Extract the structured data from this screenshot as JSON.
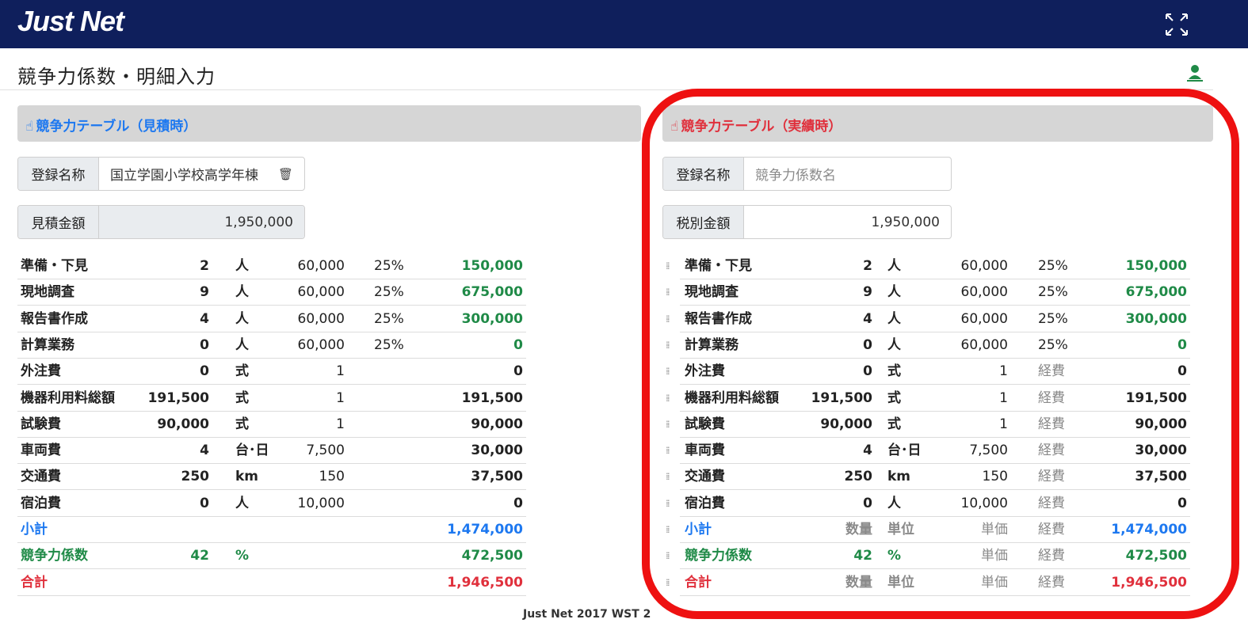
{
  "header": {
    "logo": "Just Net"
  },
  "page": {
    "title": "競争力係数・明細入力"
  },
  "left_panel": {
    "title": "競争力テーブル（見積時）",
    "fields": {
      "name_label": "登録名称",
      "name_value": "国立学園小学校高学年棟",
      "amount_label": "見積金額",
      "amount_value": "1,950,000"
    },
    "rows": [
      {
        "item": "準備・下見",
        "qty": "2",
        "unit": "人",
        "price": "60,000",
        "rate": "25%",
        "amount": "150,000",
        "kind": "green"
      },
      {
        "item": "現地調査",
        "qty": "9",
        "unit": "人",
        "price": "60,000",
        "rate": "25%",
        "amount": "675,000",
        "kind": "green"
      },
      {
        "item": "報告書作成",
        "qty": "4",
        "unit": "人",
        "price": "60,000",
        "rate": "25%",
        "amount": "300,000",
        "kind": "green"
      },
      {
        "item": "計算業務",
        "qty": "0",
        "unit": "人",
        "price": "60,000",
        "rate": "25%",
        "amount": "0",
        "kind": "green"
      },
      {
        "item": "外注費",
        "qty": "0",
        "unit": "式",
        "price": "1",
        "rate": "",
        "amount": "0",
        "kind": "black"
      },
      {
        "item": "機器利用料総額",
        "qty": "191,500",
        "unit": "式",
        "price": "1",
        "rate": "",
        "amount": "191,500",
        "kind": "black"
      },
      {
        "item": "試験費",
        "qty": "90,000",
        "unit": "式",
        "price": "1",
        "rate": "",
        "amount": "90,000",
        "kind": "black"
      },
      {
        "item": "車両費",
        "qty": "4",
        "unit": "台･日",
        "price": "7,500",
        "rate": "",
        "amount": "30,000",
        "kind": "black"
      },
      {
        "item": "交通費",
        "qty": "250",
        "unit": "km",
        "price": "150",
        "rate": "",
        "amount": "37,500",
        "kind": "black"
      },
      {
        "item": "宿泊費",
        "qty": "0",
        "unit": "人",
        "price": "10,000",
        "rate": "",
        "amount": "0",
        "kind": "black"
      }
    ],
    "summary": [
      {
        "item": "小計",
        "qty": "",
        "unit": "",
        "amount": "1,474,000",
        "kind": "blue"
      },
      {
        "item": "競争力係数",
        "qty": "42",
        "unit": "%",
        "amount": "472,500",
        "kind": "green"
      },
      {
        "item": "合計",
        "qty": "",
        "unit": "",
        "amount": "1,946,500",
        "kind": "red"
      }
    ]
  },
  "right_panel": {
    "title": "競争力テーブル（実績時）",
    "fields": {
      "name_label": "登録名称",
      "name_placeholder": "競争力係数名",
      "amount_label": "税別金額",
      "amount_value": "1,950,000"
    },
    "rows": [
      {
        "item": "準備・下見",
        "qty": "2",
        "unit": "人",
        "price": "60,000",
        "rate": "25%",
        "amount": "150,000",
        "kind": "green"
      },
      {
        "item": "現地調査",
        "qty": "9",
        "unit": "人",
        "price": "60,000",
        "rate": "25%",
        "amount": "675,000",
        "kind": "green"
      },
      {
        "item": "報告書作成",
        "qty": "4",
        "unit": "人",
        "price": "60,000",
        "rate": "25%",
        "amount": "300,000",
        "kind": "green"
      },
      {
        "item": "計算業務",
        "qty": "0",
        "unit": "人",
        "price": "60,000",
        "rate": "25%",
        "amount": "0",
        "kind": "green"
      },
      {
        "item": "外注費",
        "qty": "0",
        "unit": "式",
        "price": "1",
        "rate": "経費",
        "amount": "0",
        "kind": "black"
      },
      {
        "item": "機器利用料総額",
        "qty": "191,500",
        "unit": "式",
        "price": "1",
        "rate": "経費",
        "amount": "191,500",
        "kind": "black"
      },
      {
        "item": "試験費",
        "qty": "90,000",
        "unit": "式",
        "price": "1",
        "rate": "経費",
        "amount": "90,000",
        "kind": "black"
      },
      {
        "item": "車両費",
        "qty": "4",
        "unit": "台･日",
        "price": "7,500",
        "rate": "経費",
        "amount": "30,000",
        "kind": "black"
      },
      {
        "item": "交通費",
        "qty": "250",
        "unit": "km",
        "price": "150",
        "rate": "経費",
        "amount": "37,500",
        "kind": "black"
      },
      {
        "item": "宿泊費",
        "qty": "0",
        "unit": "人",
        "price": "10,000",
        "rate": "経費",
        "amount": "0",
        "kind": "black"
      }
    ],
    "summary": [
      {
        "item": "小計",
        "qty": "数量",
        "unit": "単位",
        "price": "単価",
        "rate": "経費",
        "amount": "1,474,000",
        "kind": "blue"
      },
      {
        "item": "競争力係数",
        "qty": "42",
        "unit": "%",
        "price": "単価",
        "rate": "経費",
        "amount": "472,500",
        "kind": "green"
      },
      {
        "item": "合計",
        "qty": "数量",
        "unit": "単位",
        "price": "単価",
        "rate": "経費",
        "amount": "1,946,500",
        "kind": "red"
      }
    ]
  },
  "footer": {
    "text": "Just Net 2017 WST 2"
  },
  "colors": {
    "header": "#0f1f5c",
    "blue": "#1d78f0",
    "green": "#1f8a47",
    "red": "#e0303c",
    "highlight": "#ee1111"
  },
  "icons": {
    "expand": "expand-icon",
    "user": "user-icon",
    "thumb": "thumb-icon",
    "trash": "trash-icon",
    "drag": "drag-handle-icon"
  }
}
